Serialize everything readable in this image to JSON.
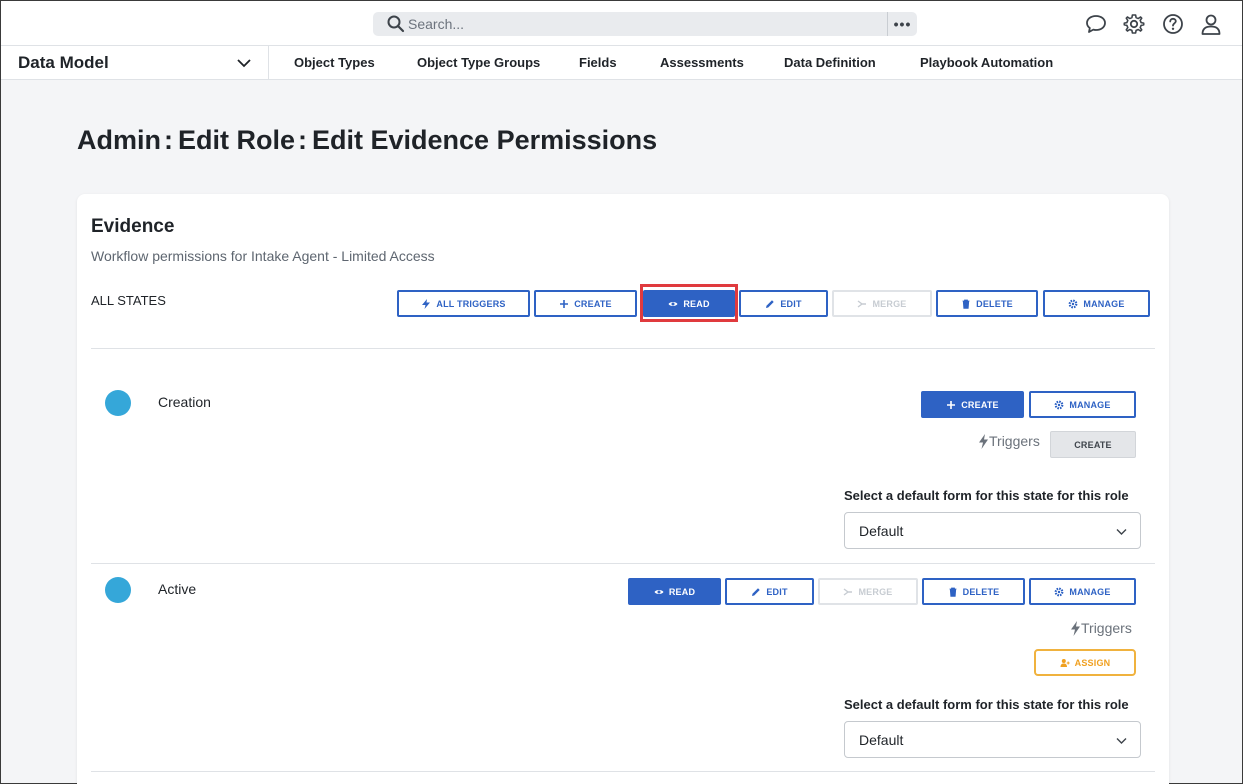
{
  "search": {
    "placeholder": "Search...",
    "more": "•••"
  },
  "topbar_icons": [
    "chat-icon",
    "gear-icon",
    "help-icon",
    "user-icon"
  ],
  "app_selector": {
    "label": "Data Model"
  },
  "nav": {
    "items": [
      {
        "label": "Object Types"
      },
      {
        "label": "Object Type Groups"
      },
      {
        "label": "Fields"
      },
      {
        "label": "Assessments"
      },
      {
        "label": "Data Definition"
      },
      {
        "label": "Playbook Automation"
      }
    ]
  },
  "page": {
    "crumb1": "Admin",
    "crumb2": "Edit Role",
    "crumb3": "Edit Evidence Permissions",
    "separator": ":"
  },
  "card": {
    "title": "Evidence",
    "subtitle": "Workflow permissions for Intake Agent - Limited Access",
    "all_states_label": "ALL STATES",
    "all_buttons": {
      "all_triggers": "ALL TRIGGERS",
      "create": "CREATE",
      "read": "READ",
      "edit": "EDIT",
      "merge": "MERGE",
      "delete": "DELETE",
      "manage": "MANAGE"
    }
  },
  "states": [
    {
      "name": "Creation",
      "buttons": {
        "create": "CREATE",
        "manage": "MANAGE"
      },
      "triggers_label": "Triggers",
      "trigger_button": "CREATE",
      "form_label": "Select a default form for this state for this role",
      "form_value": "Default"
    },
    {
      "name": "Active",
      "buttons": {
        "read": "READ",
        "edit": "EDIT",
        "merge": "MERGE",
        "delete": "DELETE",
        "manage": "MANAGE"
      },
      "triggers_label": "Triggers",
      "trigger_button": "ASSIGN",
      "form_label": "Select a default form for this state for this role",
      "form_value": "Default"
    }
  ],
  "colors": {
    "primary": "#2e62c4",
    "state_dot": "#35a7d9",
    "highlight": "#e03a3e",
    "assign": "#f0a020"
  }
}
